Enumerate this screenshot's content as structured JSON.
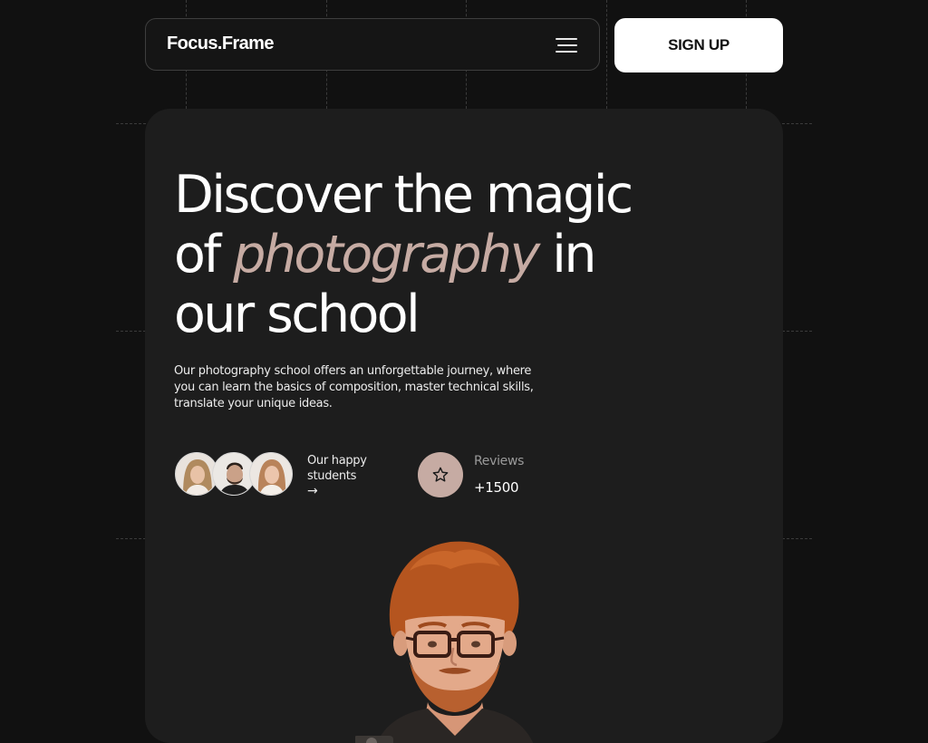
{
  "nav": {
    "logo": "Focus.Frame",
    "menu_icon": "hamburger-menu-icon",
    "signup_label": "SIGN UP"
  },
  "hero": {
    "headline_start": "Discover the magic of ",
    "headline_accent": "photography",
    "headline_end": " in our school",
    "description": "Our photography school offers an unforgettable journey, where you can learn the basics of composition, master technical skills, translate your unique ideas.",
    "students": {
      "label": "Our happy students",
      "arrow": "→"
    },
    "reviews": {
      "icon": "star-icon",
      "label": "Reviews",
      "count": "+1500"
    }
  },
  "colors": {
    "background": "#111111",
    "card": "#1d1d1d",
    "accent": "#c6aba3",
    "text": "#ffffff"
  }
}
